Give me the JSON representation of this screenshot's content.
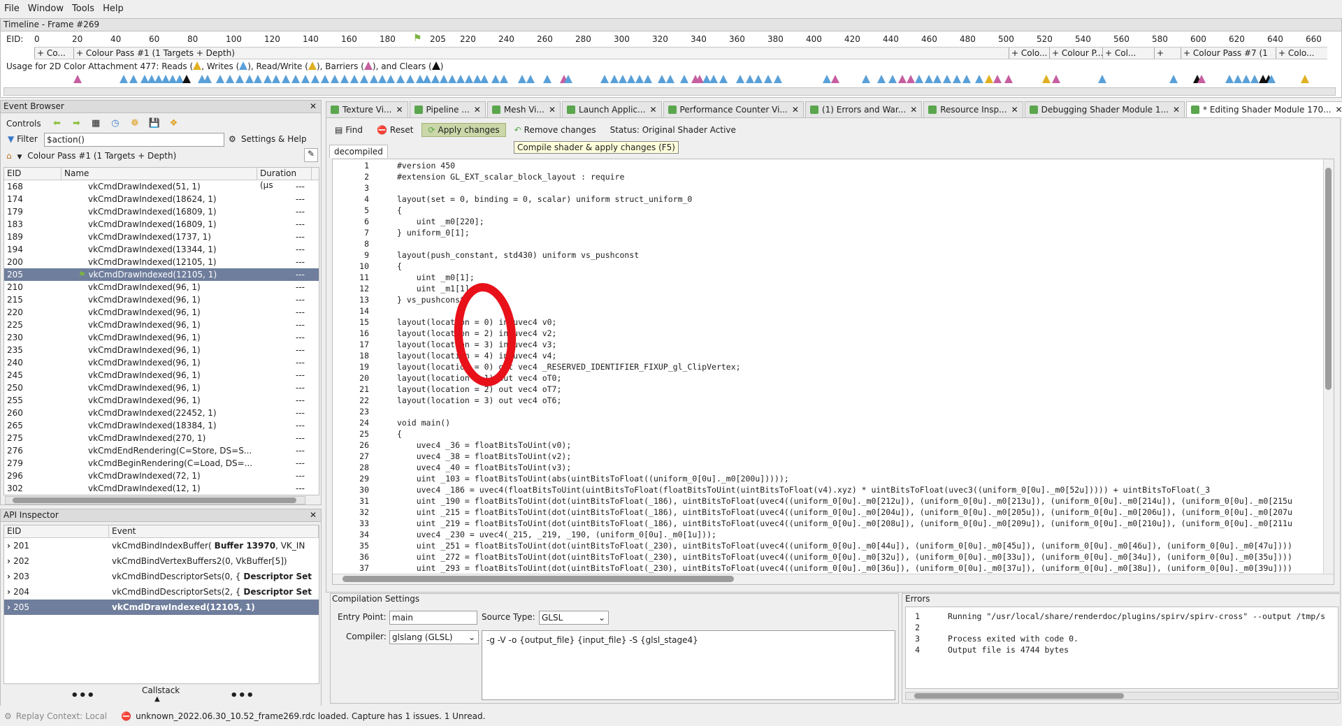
{
  "menu": [
    "File",
    "Window",
    "Tools",
    "Help"
  ],
  "timeline": {
    "title": "Timeline - Frame #269",
    "eid_label": "EID:",
    "ticks": [
      "0",
      "20",
      "40",
      "60",
      "80",
      "100",
      "120",
      "140",
      "160",
      "180",
      "205",
      "220",
      "240",
      "260",
      "280",
      "300",
      "320",
      "340",
      "360",
      "380",
      "400",
      "420",
      "440",
      "460",
      "480",
      "500",
      "520",
      "540",
      "560",
      "580",
      "600",
      "620",
      "640",
      "660"
    ],
    "passes": [
      "+ Co...",
      "+ Colour Pass #1 (1 Targets + Depth)",
      "+ Colo...",
      "+ Colour P...",
      "+ Col...",
      "+",
      "+ Colour Pass #7 (1 ...",
      "+ Colo..."
    ],
    "usage_parts": [
      "Usage for 2D Color Attachment 477: Reads (",
      ", Writes (",
      "), Read/Write (",
      "), Barriers (",
      "), and Clears (",
      ")"
    ]
  },
  "event_browser": {
    "title": "Event Browser",
    "controls_label": "Controls",
    "filter_label": "Filter",
    "filter_value": "$action()",
    "settings_label": "Settings & Help",
    "breadcrumb": "Colour Pass #1 (1 Targets + Depth)",
    "columns": [
      "EID",
      "Name",
      "Duration (µs"
    ],
    "rows": [
      {
        "eid": "168",
        "name": "vkCmdDrawIndexed(51, 1)",
        "dur": "---"
      },
      {
        "eid": "174",
        "name": "vkCmdDrawIndexed(18624, 1)",
        "dur": "---"
      },
      {
        "eid": "179",
        "name": "vkCmdDrawIndexed(16809, 1)",
        "dur": "---"
      },
      {
        "eid": "183",
        "name": "vkCmdDrawIndexed(16809, 1)",
        "dur": "---"
      },
      {
        "eid": "189",
        "name": "vkCmdDrawIndexed(1737, 1)",
        "dur": "---"
      },
      {
        "eid": "194",
        "name": "vkCmdDrawIndexed(13344, 1)",
        "dur": "---"
      },
      {
        "eid": "200",
        "name": "vkCmdDrawIndexed(12105, 1)",
        "dur": "---"
      },
      {
        "eid": "205",
        "name": "vkCmdDrawIndexed(12105, 1)",
        "dur": "---",
        "selected": true
      },
      {
        "eid": "210",
        "name": "vkCmdDrawIndexed(96, 1)",
        "dur": "---"
      },
      {
        "eid": "215",
        "name": "vkCmdDrawIndexed(96, 1)",
        "dur": "---"
      },
      {
        "eid": "220",
        "name": "vkCmdDrawIndexed(96, 1)",
        "dur": "---"
      },
      {
        "eid": "225",
        "name": "vkCmdDrawIndexed(96, 1)",
        "dur": "---"
      },
      {
        "eid": "230",
        "name": "vkCmdDrawIndexed(96, 1)",
        "dur": "---"
      },
      {
        "eid": "235",
        "name": "vkCmdDrawIndexed(96, 1)",
        "dur": "---"
      },
      {
        "eid": "240",
        "name": "vkCmdDrawIndexed(96, 1)",
        "dur": "---"
      },
      {
        "eid": "245",
        "name": "vkCmdDrawIndexed(96, 1)",
        "dur": "---"
      },
      {
        "eid": "250",
        "name": "vkCmdDrawIndexed(96, 1)",
        "dur": "---"
      },
      {
        "eid": "255",
        "name": "vkCmdDrawIndexed(96, 1)",
        "dur": "---"
      },
      {
        "eid": "260",
        "name": "vkCmdDrawIndexed(22452, 1)",
        "dur": "---"
      },
      {
        "eid": "265",
        "name": "vkCmdDrawIndexed(18384, 1)",
        "dur": "---"
      },
      {
        "eid": "275",
        "name": "vkCmdDrawIndexed(270, 1)",
        "dur": "---"
      },
      {
        "eid": "276",
        "name": "vkCmdEndRendering(C=Store, DS=S...",
        "dur": "---"
      },
      {
        "eid": "279",
        "name": "vkCmdBeginRendering(C=Load, DS=...",
        "dur": "---"
      },
      {
        "eid": "296",
        "name": "vkCmdDrawIndexed(72, 1)",
        "dur": "---"
      },
      {
        "eid": "302",
        "name": "vkCmdDrawIndexed(12, 1)",
        "dur": "---"
      }
    ]
  },
  "api_inspector": {
    "title": "API Inspector",
    "columns": [
      "EID",
      "Event"
    ],
    "rows": [
      {
        "eid": "201",
        "event": "vkCmdBindIndexBuffer(",
        "bold": "Buffer 13970",
        "rest": ",  VK_IN"
      },
      {
        "eid": "202",
        "event": "vkCmdBindVertexBuffers2(0, VkBuffer[5])",
        "bold": "",
        "rest": ""
      },
      {
        "eid": "203",
        "event": "vkCmdBindDescriptorSets(0,  {",
        "bold": "Descriptor Set",
        "rest": ""
      },
      {
        "eid": "204",
        "event": "vkCmdBindDescriptorSets(2,  {",
        "bold": "Descriptor Set",
        "rest": ""
      },
      {
        "eid": "205",
        "event": "vkCmdDrawIndexed(12105, 1)",
        "bold": "",
        "rest": "",
        "selected": true
      }
    ],
    "callstack_label": "Callstack"
  },
  "tabs": [
    {
      "label": "Texture Vi..."
    },
    {
      "label": "Pipeline ..."
    },
    {
      "label": "Mesh Vi..."
    },
    {
      "label": "Launch Applic..."
    },
    {
      "label": "Performance Counter Vi..."
    },
    {
      "label": "(1) Errors and War..."
    },
    {
      "label": "Resource Insp..."
    },
    {
      "label": "Debugging Shader Module 1..."
    },
    {
      "label": "* Editing Shader Module 170...",
      "active": true
    }
  ],
  "editor": {
    "find_label": "Find",
    "reset_label": "Reset",
    "apply_label": "Apply changes",
    "remove_label": "Remove changes",
    "status_label": "Status: Original Shader Active",
    "tooltip": "Compile shader & apply changes (F5)",
    "subtab": "decompiled",
    "lines": [
      "#version 450",
      "#extension GL_EXT_scalar_block_layout : require",
      "",
      "layout(set = 0, binding = 0, scalar) uniform struct_uniform_0",
      "{",
      "    uint _m0[220];",
      "} uniform_0[1];",
      "",
      "layout(push_constant, std430) uniform vs_pushconst",
      "{",
      "    uint _m0[1];",
      "    uint _m1[1];",
      "} vs_pushconst;",
      "",
      "layout(location = 0) in uvec4 v0;",
      "layout(location = 2) in uvec4 v2;",
      "layout(location = 3) in uvec4 v3;",
      "layout(location = 4) in uvec4 v4;",
      "layout(location = 0) out vec4 _RESERVED_IDENTIFIER_FIXUP_gl_ClipVertex;",
      "layout(location = 1) out vec4 oT0;",
      "layout(location = 2) out vec4 oT7;",
      "layout(location = 3) out vec4 oT6;",
      "",
      "void main()",
      "{",
      "    uvec4 _36 = floatBitsToUint(v0);",
      "    uvec4 _38 = floatBitsToUint(v2);",
      "    uvec4 _40 = floatBitsToUint(v3);",
      "    uint _103 = floatBitsToUint(abs(uintBitsToFloat((uniform_0[0u]._m0[200u]))));",
      "    uvec4 _186 = uvec4(floatBitsToUint(uintBitsToFloat(floatBitsToUint(uintBitsToFloat(v4).xyz) * uintBitsToFloat(uvec3((uniform_0[0u]._m0[52u])))) + uintBitsToFloat(_3",
      "    uint _190 = floatBitsToUint(dot(uintBitsToFloat(_186), uintBitsToFloat(uvec4((uniform_0[0u]._m0[212u]), (uniform_0[0u]._m0[213u]), (uniform_0[0u]._m0[214u]), (uniform_0[0u]._m0[215u",
      "    uint _215 = floatBitsToUint(dot(uintBitsToFloat(_186), uintBitsToFloat(uvec4((uniform_0[0u]._m0[204u]), (uniform_0[0u]._m0[205u]), (uniform_0[0u]._m0[206u]), (uniform_0[0u]._m0[207u",
      "    uint _219 = floatBitsToUint(dot(uintBitsToFloat(_186), uintBitsToFloat(uvec4((uniform_0[0u]._m0[208u]), (uniform_0[0u]._m0[209u]), (uniform_0[0u]._m0[210u]), (uniform_0[0u]._m0[211u",
      "    uvec4 _230 = uvec4(_215, _219, _190, (uniform_0[0u]._m0[1u]));",
      "    uint _251 = floatBitsToUint(dot(uintBitsToFloat(_230), uintBitsToFloat(uvec4((uniform_0[0u]._m0[44u]), (uniform_0[0u]._m0[45u]), (uniform_0[0u]._m0[46u]), (uniform_0[0u]._m0[47u])))",
      "    uint _272 = floatBitsToUint(dot(uintBitsToFloat(_230), uintBitsToFloat(uvec4((uniform_0[0u]._m0[32u]), (uniform_0[0u]._m0[33u]), (uniform_0[0u]._m0[34u]), (uniform_0[0u]._m0[35u])))",
      "    uint _293 = floatBitsToUint(dot(uintBitsToFloat(_230), uintBitsToFloat(uvec4((uniform_0[0u]._m0[36u]), (uniform_0[0u]._m0[37u]), (uniform_0[0u]._m0[38u]), (uniform_0[0u]._m0[39u])))"
    ]
  },
  "compilation": {
    "title": "Compilation Settings",
    "entry_label": "Entry Point:",
    "entry_value": "main",
    "source_label": "Source Type:",
    "source_value": "GLSL",
    "compiler_label": "Compiler:",
    "compiler_value": "glslang (GLSL)",
    "args": "-g -V -o {output_file} {input_file} -S {glsl_stage4}"
  },
  "errors": {
    "title": "Errors",
    "lines": [
      "Running \"/usr/local/share/renderdoc/plugins/spirv/spirv-cross\" --output /tmp/s",
      "",
      "Process exited with code 0.",
      "Output file is 4744 bytes"
    ]
  },
  "statusbar": {
    "context": "Replay Context: Local",
    "message": "unknown_2022.06.30_10.52_frame269.rdc loaded. Capture has 1 issues. 1 Unread."
  }
}
